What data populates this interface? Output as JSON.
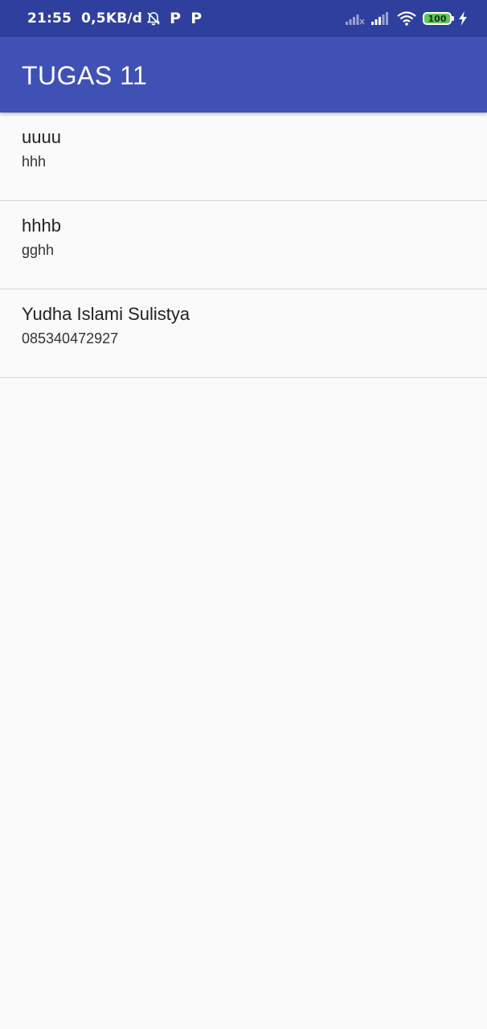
{
  "status_bar": {
    "time": "21:55",
    "net_speed": "0,5KB/d",
    "notification_icons": [
      "bell-off-icon",
      "p-app-icon",
      "p-app-icon"
    ],
    "p_glyph": "P",
    "battery_level": "100",
    "status_icons": [
      "signal-no-sim-icon",
      "signal-icon",
      "wifi-icon",
      "battery-icon",
      "charging-icon"
    ]
  },
  "app_bar": {
    "title": "TUGAS 11",
    "color": "#3f51b5",
    "status_color": "#2f3f9e"
  },
  "contacts": [
    {
      "name": "uuuu",
      "detail": "hhh"
    },
    {
      "name": "hhhb",
      "detail": "gghh"
    },
    {
      "name": "Yudha Islami Sulistya",
      "detail": "085340472927"
    }
  ]
}
